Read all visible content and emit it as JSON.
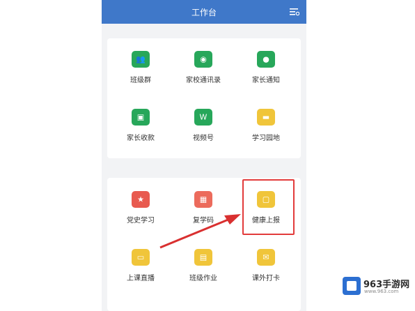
{
  "header": {
    "title": "工作台"
  },
  "sections": [
    {
      "label": "",
      "items": [
        {
          "label": "班级群",
          "icon": "people-icon",
          "color": "#27a75a"
        },
        {
          "label": "家校通讯录",
          "icon": "contact-icon",
          "color": "#27a75a"
        },
        {
          "label": "家长通知",
          "icon": "chat-icon",
          "color": "#27a75a"
        },
        {
          "label": "家长收款",
          "icon": "payment-icon",
          "color": "#27a75a"
        },
        {
          "label": "视频号",
          "icon": "video-icon",
          "color": "#27a75a"
        },
        {
          "label": "学习园地",
          "icon": "learning-icon",
          "color": "#f0c53a"
        }
      ]
    },
    {
      "label": "",
      "items": [
        {
          "label": "党史学习",
          "icon": "star-icon",
          "color": "#e85a4f"
        },
        {
          "label": "复学码",
          "icon": "qr-icon",
          "color": "#ec6b5c"
        },
        {
          "label": "健康上报",
          "icon": "health-report-icon",
          "color": "#f0c53a"
        },
        {
          "label": "上课直播",
          "icon": "live-icon",
          "color": "#f0c53a"
        },
        {
          "label": "班级作业",
          "icon": "homework-icon",
          "color": "#f0c53a"
        },
        {
          "label": "课外打卡",
          "icon": "checkin-icon",
          "color": "#f0c53a"
        }
      ]
    }
  ],
  "watermark": {
    "brand": "963手游网",
    "url": "www.963.com"
  },
  "colors": {
    "header": "#3f78c9",
    "highlight": "#e23b3b"
  }
}
